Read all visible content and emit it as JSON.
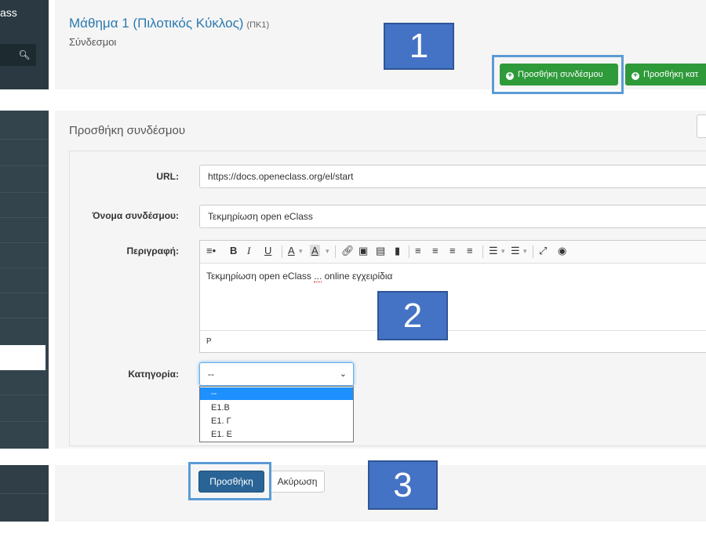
{
  "sidebar": {
    "logo_text": "ass",
    "search_icon": "search-icon"
  },
  "header": {
    "course_title": "Μάθημα 1 (Πιλοτικός Κύκλος)",
    "course_code": "(ΠΚ1)",
    "subtitle": "Σύνδεσμοι",
    "add_link_button": "Προσθήκη συνδέσμου",
    "add_category_button": "Προσθήκη κατ"
  },
  "form": {
    "heading": "Προσθήκη συνδέσμου",
    "url_label": "URL:",
    "url_value": "https://docs.openeclass.org/el/start",
    "name_label": "Όνομα συνδέσμου:",
    "name_value": "Τεκμηρίωση open eClass",
    "description_label": "Περιγραφή:",
    "editor_text_before": "Τεκμηρίωση open eClass ",
    "editor_text_squig": "...",
    "editor_text_after": " online εγχειρίδια",
    "editor_status": "P",
    "category_label": "Κατηγορία:",
    "category_selected": "--",
    "category_options": [
      "--",
      "Ε1.Β",
      "Ε1. Γ",
      "Ε1. Ε"
    ]
  },
  "actions": {
    "submit_label": "Προσθήκη",
    "cancel_label": "Ακύρωση"
  },
  "callouts": [
    "1",
    "2",
    "3"
  ],
  "colors": {
    "accent_green": "#2e9a3a",
    "primary_blue": "#2a6496",
    "callout_blue": "#4472c4",
    "highlight_blue": "#5b9bd5",
    "sidebar_dark": "#2f3e47"
  }
}
